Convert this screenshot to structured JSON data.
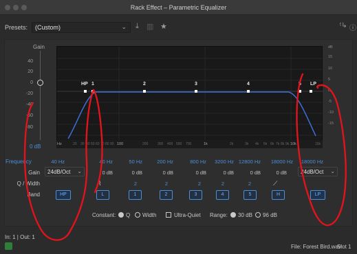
{
  "window": {
    "title": "Rack Effect – Parametric Equalizer"
  },
  "presets": {
    "label": "Presets:",
    "value": "(Custom)"
  },
  "graph": {
    "gain_label": "Gain",
    "left_ticks": [
      "40",
      "20",
      "0",
      "-20",
      "-40",
      "-60",
      "-80"
    ],
    "master_gain": "0 dB",
    "right_ticks": [
      "dB",
      "15",
      "10",
      "5",
      "0",
      "-5",
      "-10",
      "-15"
    ],
    "x_ticks": [
      "Hz",
      "20",
      "30",
      "40",
      "50",
      "60",
      "70",
      "80",
      "90",
      "100",
      "200",
      "300",
      "400",
      "500",
      "700",
      "1k",
      "2k",
      "3k",
      "4k",
      "5k",
      "6k",
      "7k",
      "8k",
      "9k",
      "10k",
      "15k"
    ],
    "band_markers": [
      "HP",
      "1",
      "2",
      "3",
      "4",
      "5",
      "LP"
    ],
    "response_color": "#3d6fd8"
  },
  "table": {
    "row_labels": {
      "frequency": "Frequency",
      "gain": "Gain",
      "q_width": "Q / Width",
      "band": "Band"
    },
    "hp": {
      "freq": "40 Hz",
      "gain": "24dB/Oct",
      "band": "HP"
    },
    "bands": [
      {
        "freq": "40 Hz",
        "gain": "0 dB",
        "q": "",
        "band": "L"
      },
      {
        "freq": "50 Hz",
        "gain": "0 dB",
        "q": "2",
        "band": "1"
      },
      {
        "freq": "200 Hz",
        "gain": "0 dB",
        "q": "2",
        "band": "2"
      },
      {
        "freq": "800 Hz",
        "gain": "0 dB",
        "q": "2",
        "band": "3"
      },
      {
        "freq": "3200 Hz",
        "gain": "0 dB",
        "q": "2",
        "band": "4"
      },
      {
        "freq": "12800 Hz",
        "gain": "0 dB",
        "q": "2",
        "band": "5"
      },
      {
        "freq": "18000 Hz",
        "gain": "0 dB",
        "q": "",
        "band": "H"
      }
    ],
    "lp": {
      "freq": "18000 Hz",
      "gain": "24dB/Oct",
      "band": "LP"
    }
  },
  "options": {
    "constant_label": "Constant:",
    "q_label": "Q",
    "width_label": "Width",
    "ultra_quiet_label": "Ultra-Quiet",
    "range_label": "Range:",
    "range_30": "30 dB",
    "range_96": "96 dB"
  },
  "status": {
    "io": "In: 1 | Out: 1",
    "file": "File: Forest Bird.wav",
    "slot": "Slot 1"
  },
  "annotation_color": "#e0141c",
  "accent_color": "#4a90d9"
}
